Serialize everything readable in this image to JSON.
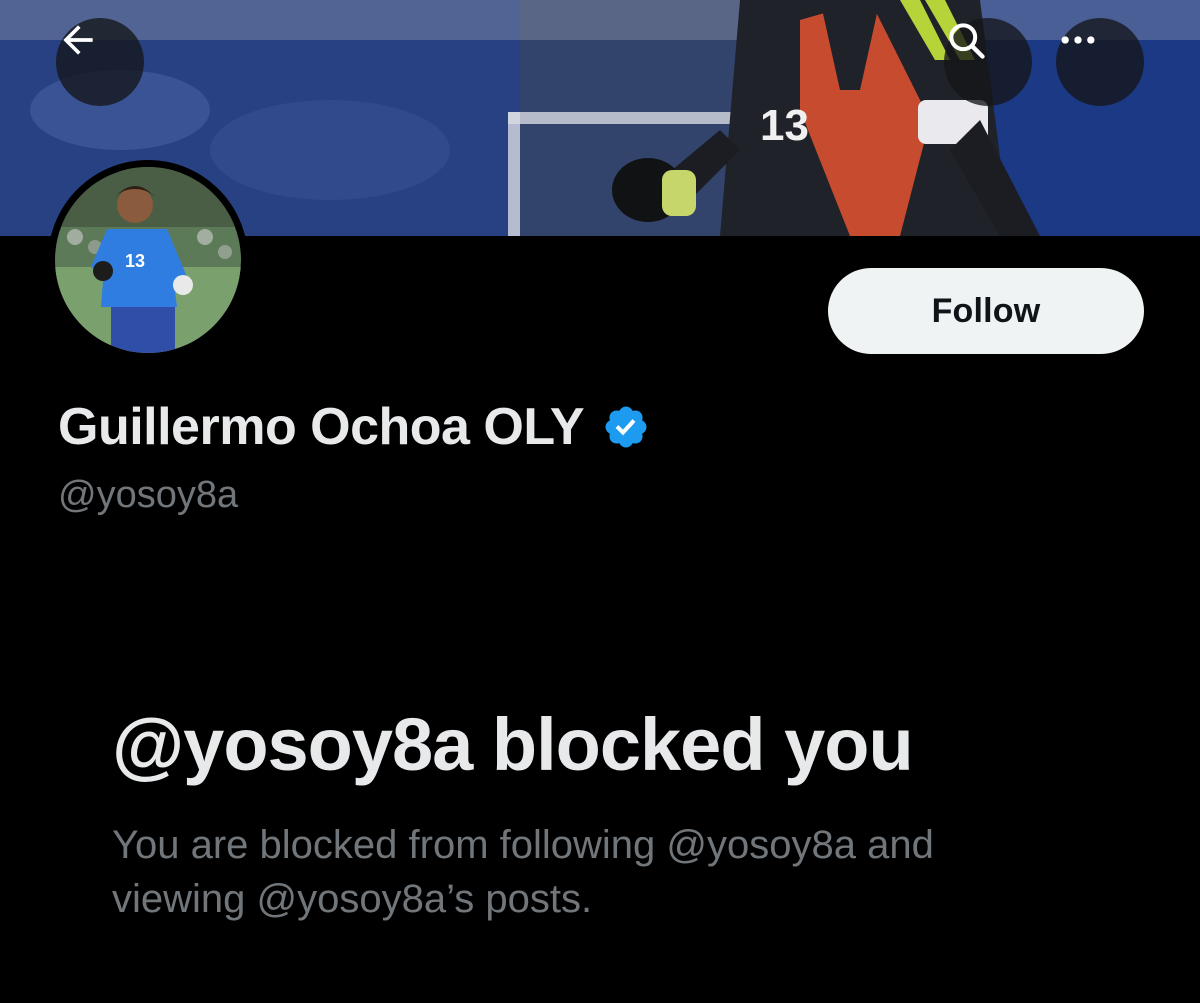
{
  "header": {
    "back_icon": "arrow-left-icon",
    "search_icon": "search-icon",
    "more_icon": "more-horizontal-icon"
  },
  "profile": {
    "display_name": "Guillermo Ochoa OLY",
    "handle": "@yosoy8a",
    "verified": true,
    "verified_color": "#1d9bf0",
    "jersey_number": "13",
    "follow_label": "Follow"
  },
  "blocked": {
    "title": "@yosoy8a blocked you",
    "description": "You are blocked from following @yosoy8a and viewing @yosoy8a’s posts."
  },
  "colors": {
    "background": "#000000",
    "primary_text": "#e7e9ea",
    "secondary_text": "#71767b",
    "follow_button_bg": "#eff3f4",
    "follow_button_text": "#0f1419"
  }
}
